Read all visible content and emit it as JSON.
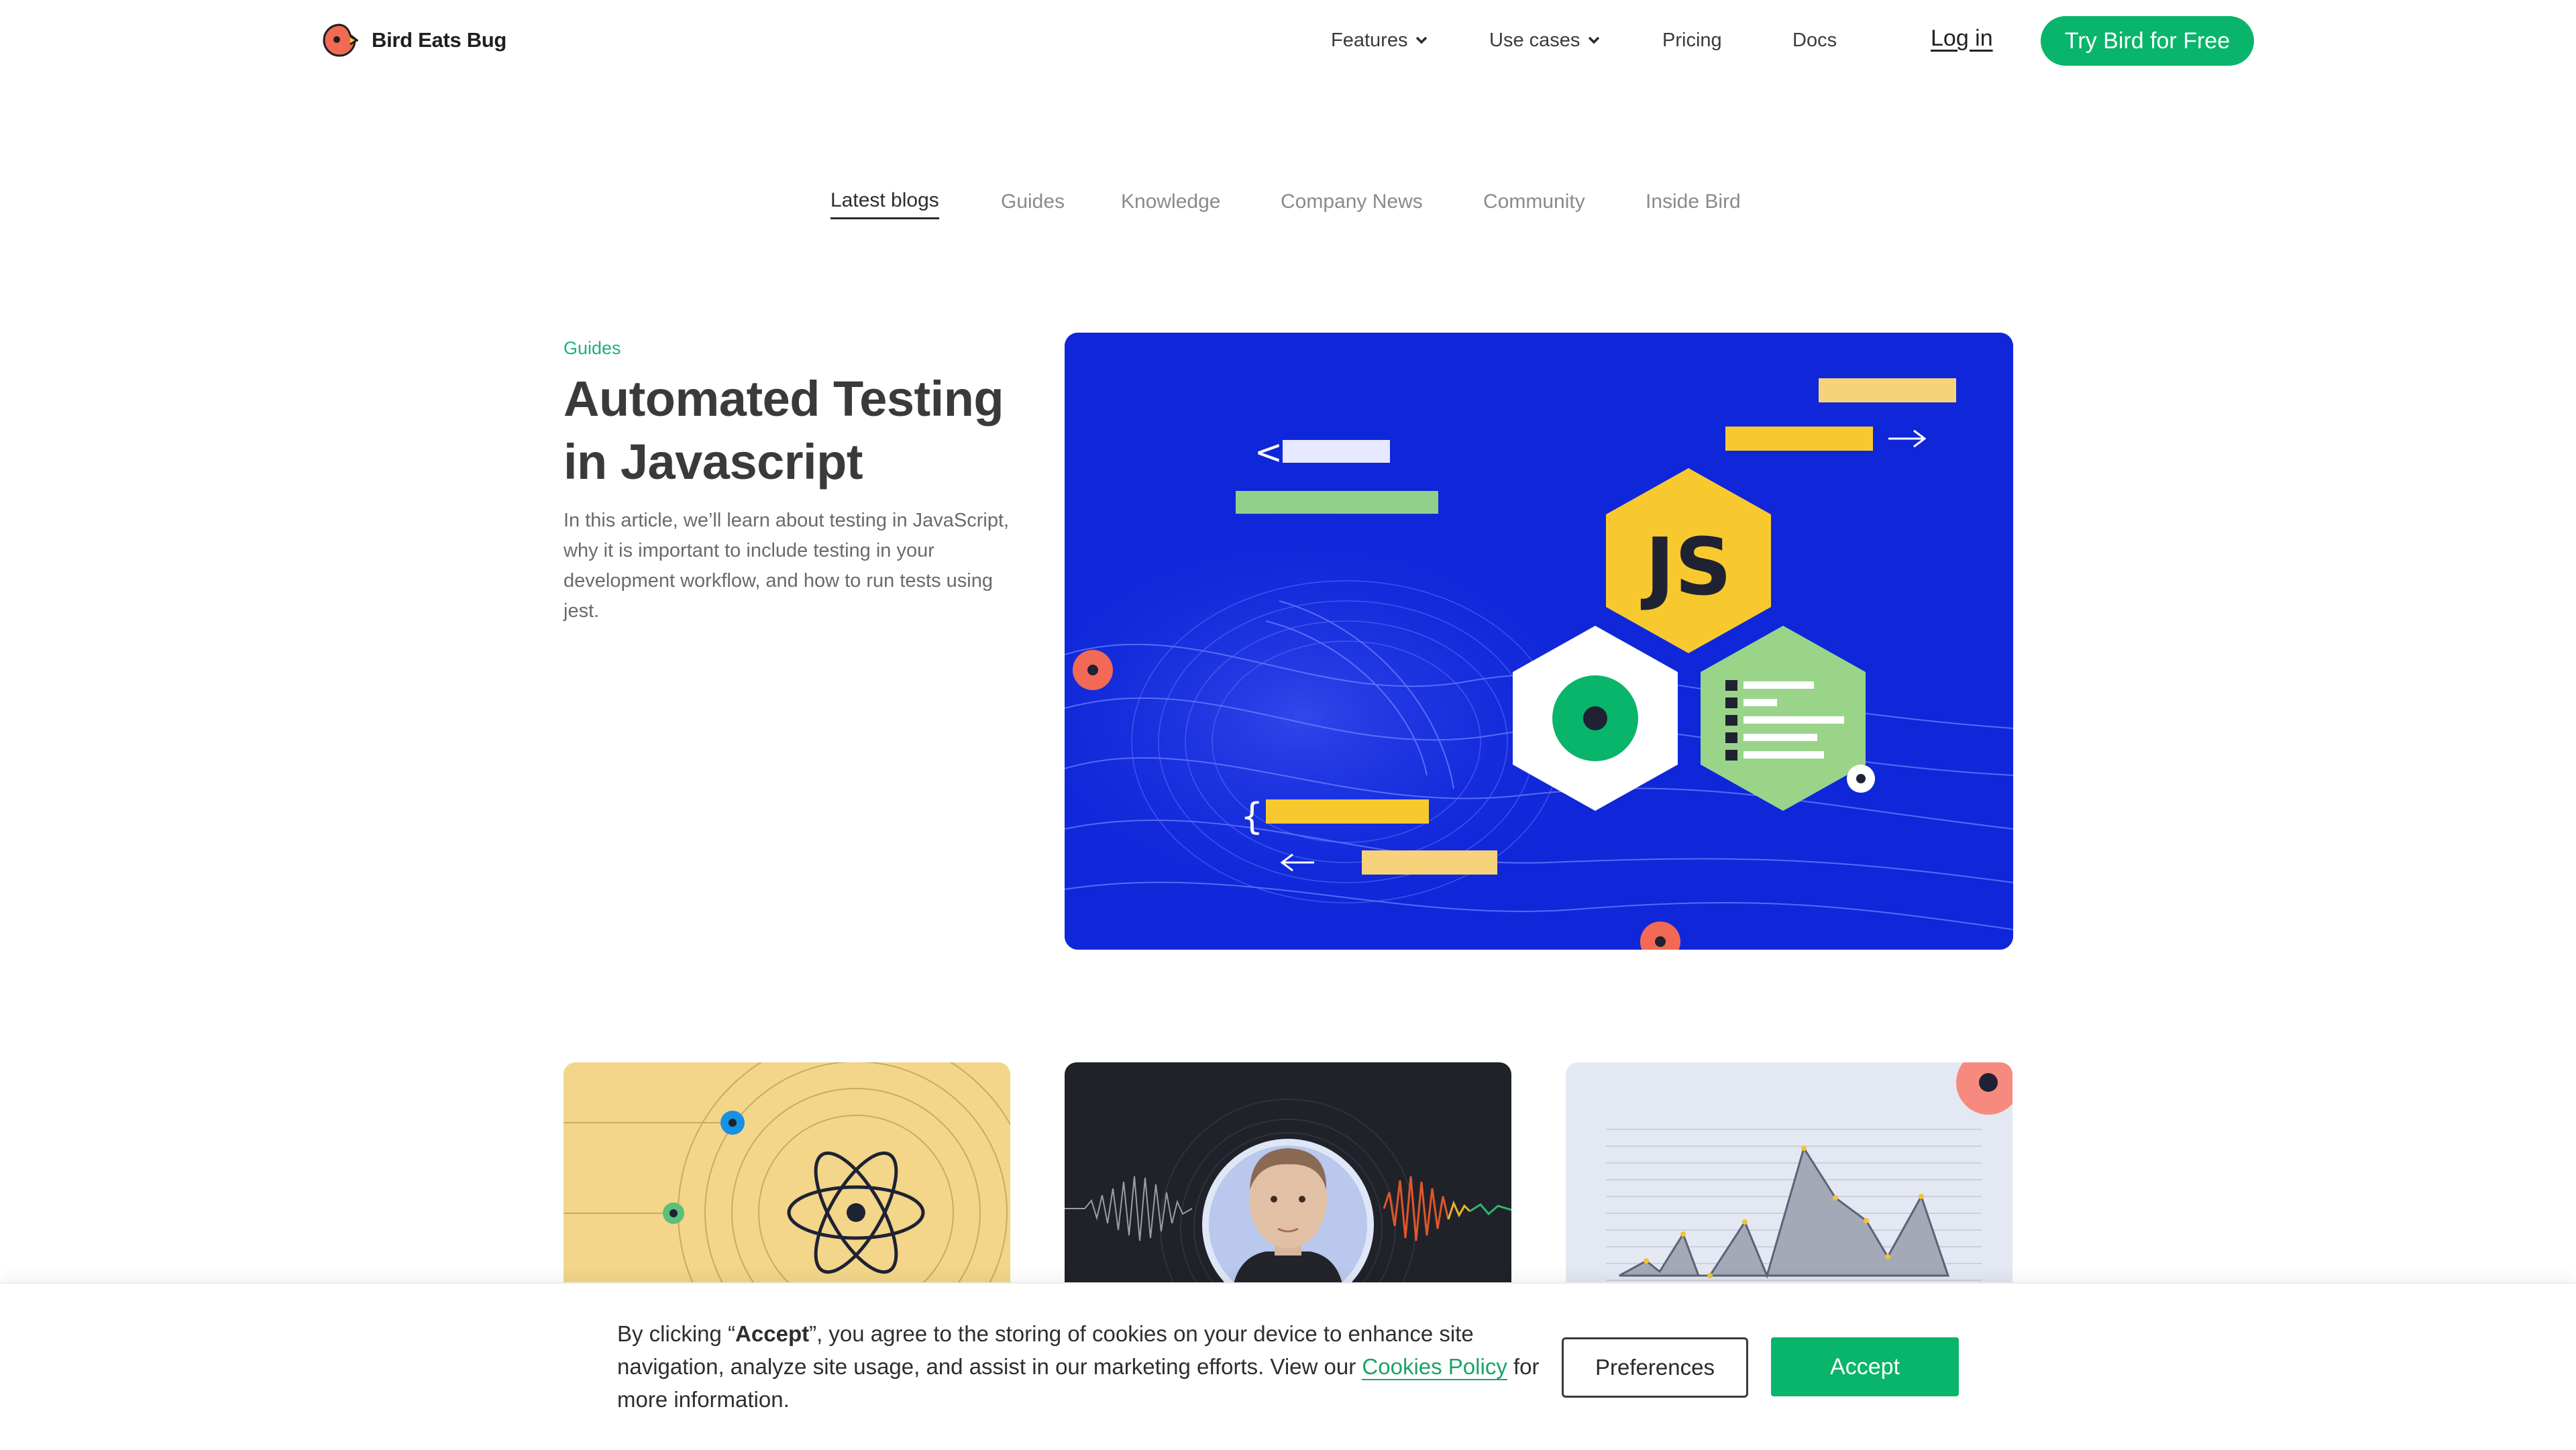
{
  "header": {
    "brand": "Bird Eats Bug",
    "nav": {
      "features": "Features",
      "use_cases": "Use cases",
      "pricing": "Pricing",
      "docs": "Docs"
    },
    "login": "Log in",
    "cta": "Try Bird for Free"
  },
  "blog_tabs": {
    "items": [
      "Latest blogs",
      "Guides",
      "Knowledge",
      "Company News",
      "Community",
      "Inside Bird"
    ],
    "active": "Latest blogs"
  },
  "featured": {
    "category": "Guides",
    "title": "Automated Testing in Javascript",
    "description": "In this article, we’ll learn about testing in JavaScript, why it is important to include testing in your development workflow, and how to run tests using jest.",
    "image_badge": "JS"
  },
  "cards": [
    {
      "image": "react-atom-illustration"
    },
    {
      "image": "podcast-guest-portrait"
    },
    {
      "image": "analytics-chart-illustration"
    }
  ],
  "cookie_banner": {
    "text_before": "By clicking “",
    "text_bold": "Accept",
    "text_after": "”, you agree to the storing of cookies on your device to enhance site navigation, analyze site usage, and assist in our marketing efforts. View our ",
    "link": "Cookies Policy",
    "text_end": " for more information.",
    "preferences": "Preferences",
    "accept": "Accept"
  },
  "colors": {
    "brand_green": "#09b56b",
    "hero_blue": "#0f27d9",
    "js_yellow": "#f8c92f",
    "coral": "#f26a55"
  }
}
